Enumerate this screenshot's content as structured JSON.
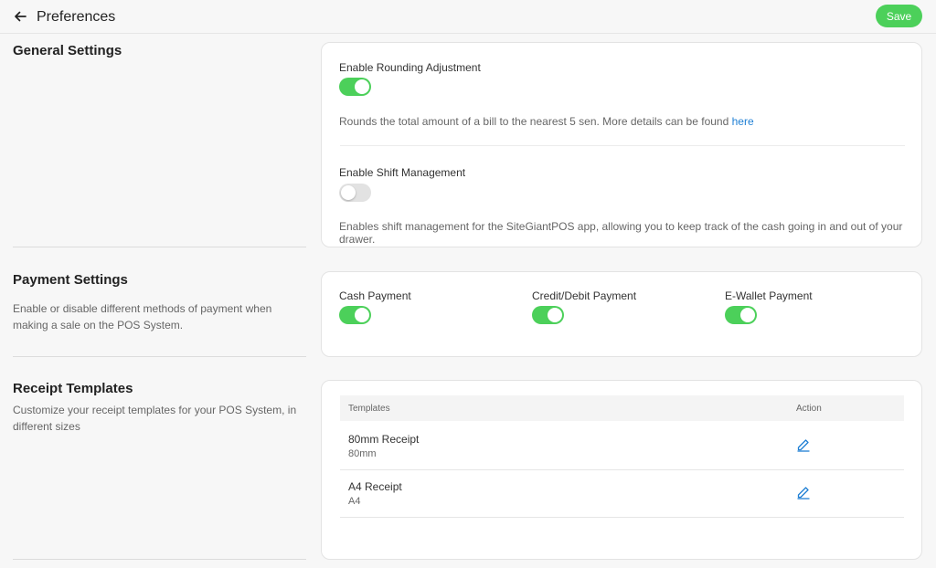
{
  "header": {
    "title": "Preferences",
    "save_label": "Save"
  },
  "general": {
    "title": "General Settings",
    "rounding": {
      "label": "Enable Rounding Adjustment",
      "enabled": true,
      "help": "Rounds the total amount of a bill to the nearest 5 sen. More details can be found ",
      "link": "here"
    },
    "shift": {
      "label": "Enable Shift Management",
      "enabled": false,
      "help": "Enables shift management for the SiteGiantPOS app, allowing you to keep track of the cash going in and out of your drawer."
    }
  },
  "payment": {
    "title": "Payment Settings",
    "desc": "Enable or disable different methods of payment when making a sale on the POS System.",
    "methods": [
      {
        "label": "Cash Payment",
        "enabled": true
      },
      {
        "label": "Credit/Debit Payment",
        "enabled": true
      },
      {
        "label": "E-Wallet Payment",
        "enabled": true
      }
    ]
  },
  "receipts": {
    "title": "Receipt Templates",
    "desc": "Customize your receipt templates for your POS System, in different sizes",
    "columns": {
      "templates": "Templates",
      "action": "Action"
    },
    "rows": [
      {
        "name": "80mm Receipt",
        "size": "80mm",
        "action_icon": "edit-icon"
      },
      {
        "name": "A4 Receipt",
        "size": "A4",
        "action_icon": "edit-icon"
      }
    ]
  },
  "colors": {
    "accent_green": "#4cd05a",
    "link_blue": "#1f7fd4"
  }
}
